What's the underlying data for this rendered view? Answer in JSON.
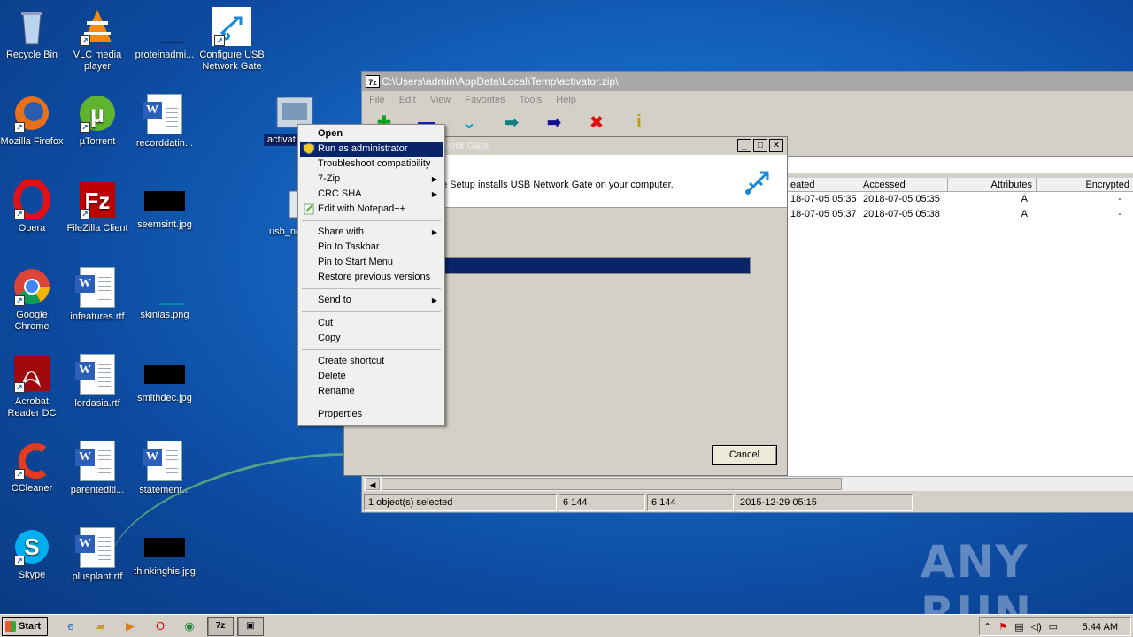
{
  "desktop_icons": [
    {
      "label": "Recycle Bin"
    },
    {
      "label": "VLC media player"
    },
    {
      "label": "proteinadmi..."
    },
    {
      "label": "Configure USB Network Gate"
    },
    {
      "label": "Mozilla Firefox"
    },
    {
      "label": "µTorrent"
    },
    {
      "label": "recorddatin..."
    },
    {
      "label": "activat"
    },
    {
      "label": "Opera"
    },
    {
      "label": "FileZilla Client"
    },
    {
      "label": "seemsint.jpg"
    },
    {
      "label": "usb_ne"
    },
    {
      "label": "Google Chrome"
    },
    {
      "label": "infeatures.rtf"
    },
    {
      "label": "skinlas.png"
    },
    {
      "label": "Acrobat Reader DC"
    },
    {
      "label": "lordasia.rtf"
    },
    {
      "label": "smithdec.jpg"
    },
    {
      "label": "CCleaner"
    },
    {
      "label": "parentediti..."
    },
    {
      "label": "statement..."
    },
    {
      "label": "Skype"
    },
    {
      "label": "plusplant.rtf"
    },
    {
      "label": "thinkinghis.jpg"
    }
  ],
  "zip_window": {
    "title": "C:\\Users\\admin\\AppData\\Local\\Temp\\activator.zip\\",
    "menu": [
      "File",
      "Edit",
      "View",
      "Favorites",
      "Tools",
      "Help"
    ],
    "toolbar_icons": [
      "add-icon",
      "extract-icon",
      "test-icon",
      "copy-icon",
      "move-icon",
      "delete-icon",
      "info-icon"
    ],
    "columns": [
      "eated",
      "Accessed",
      "Attributes",
      "Encrypted"
    ],
    "rows": [
      {
        "created": "18-07-05 05:35",
        "accessed": "2018-07-05 05:35",
        "attributes": "A",
        "encrypted": "-"
      },
      {
        "created": "18-07-05 05:37",
        "accessed": "2018-07-05 05:38",
        "attributes": "A",
        "encrypted": "-"
      }
    ],
    "status": {
      "selected": "1 object(s) selected",
      "size": "6 144",
      "packed": "6 144",
      "modified": "2015-12-29 05:15"
    }
  },
  "setup_dialog": {
    "title": "work Gate",
    "message": "e Setup installs USB Network Gate on your computer.",
    "progress": 1.0,
    "cancel_label": "Cancel"
  },
  "context_menu": {
    "items": [
      {
        "label": "Open"
      },
      {
        "label": "Run as administrator"
      },
      {
        "label": "Troubleshoot compatibility"
      },
      {
        "label": "7-Zip"
      },
      {
        "label": "CRC SHA"
      },
      {
        "label": "Edit with Notepad++"
      },
      {
        "label": "Share with"
      },
      {
        "label": "Pin to Taskbar"
      },
      {
        "label": "Pin to Start Menu"
      },
      {
        "label": "Restore previous versions"
      },
      {
        "label": "Send to"
      },
      {
        "label": "Cut"
      },
      {
        "label": "Copy"
      },
      {
        "label": "Create shortcut"
      },
      {
        "label": "Delete"
      },
      {
        "label": "Rename"
      },
      {
        "label": "Properties"
      }
    ]
  },
  "taskbar": {
    "start_label": "Start",
    "task_7z_label": "7z",
    "clock": "5:44 AM"
  },
  "watermark": "ANY RUN",
  "colors": {
    "selection": "#0a246a",
    "desktop": "#1565c0"
  }
}
